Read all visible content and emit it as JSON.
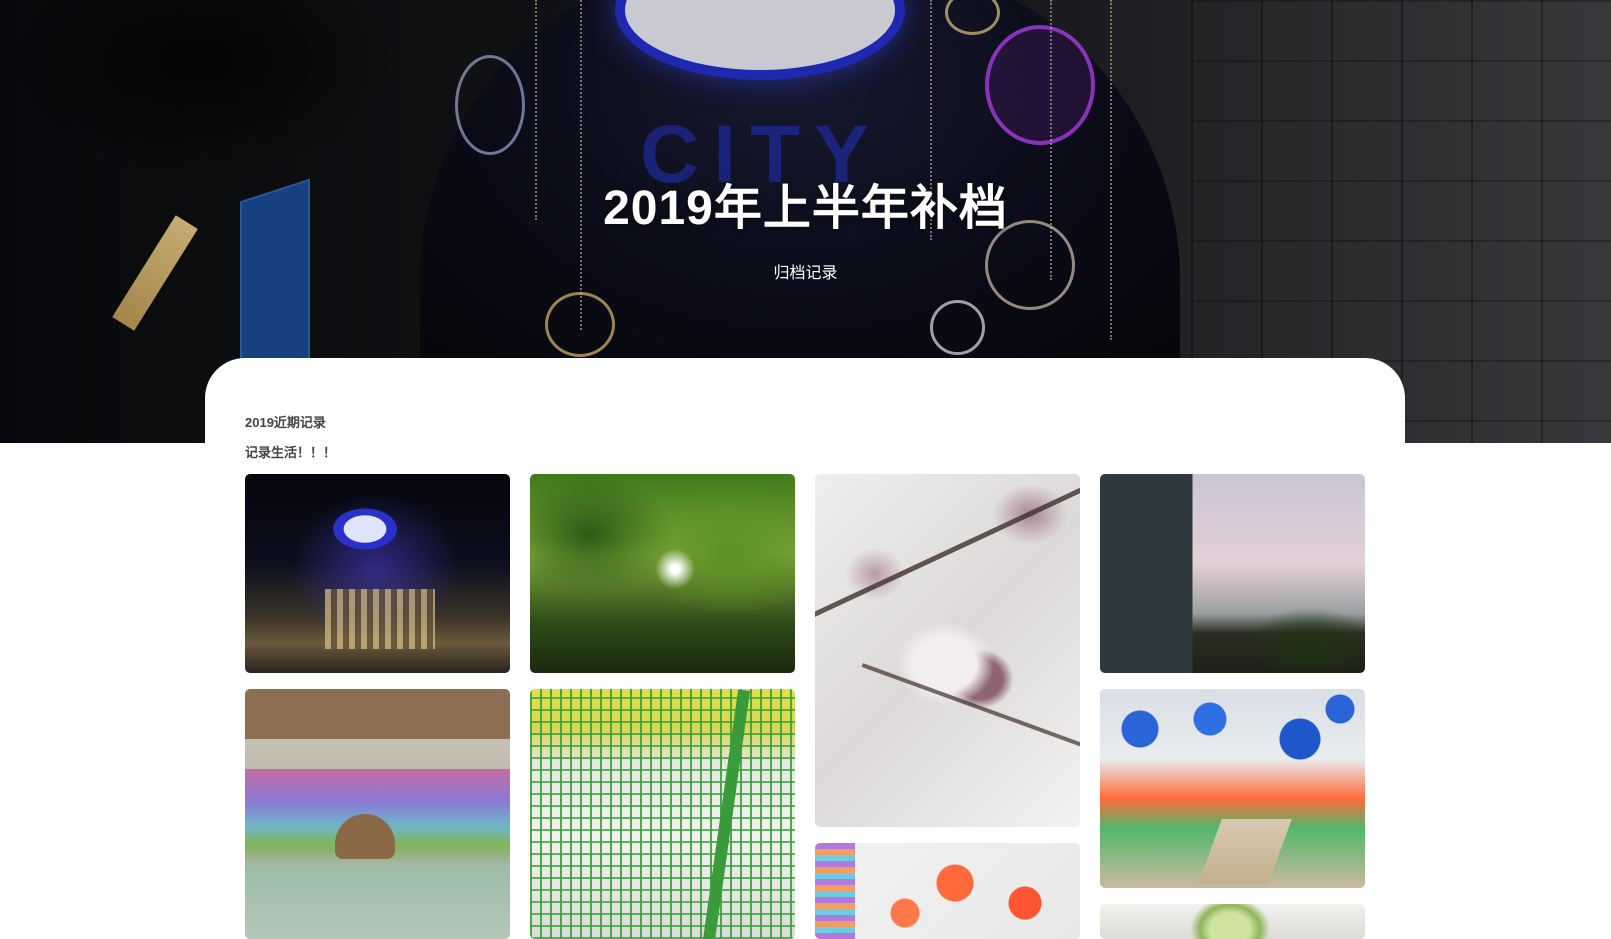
{
  "hero": {
    "title": "2019年上半年补档",
    "subtitle": "归档记录"
  },
  "section": {
    "title": "2019近期记录",
    "description": "记录生活！！！"
  },
  "gallery": {
    "photos": [
      {
        "name": "photo-mall-night"
      },
      {
        "name": "photo-trees"
      },
      {
        "name": "photo-cherry-blossom"
      },
      {
        "name": "photo-street-dusk"
      },
      {
        "name": "photo-deer-mural"
      },
      {
        "name": "photo-doves-fence"
      },
      {
        "name": "photo-pinwheels-red"
      },
      {
        "name": "photo-pinwheels-blue"
      },
      {
        "name": "photo-green-flower"
      }
    ]
  },
  "colors": {
    "background": "#ffffff",
    "text_muted": "#444444",
    "hero_text": "#ffffff"
  }
}
